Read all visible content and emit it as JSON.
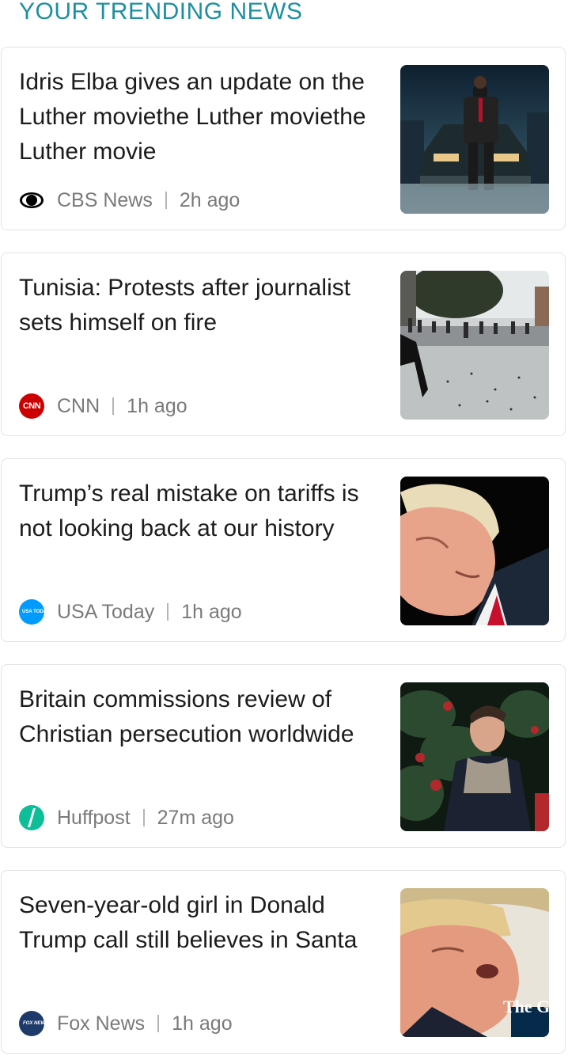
{
  "section": {
    "title": "YOUR TRENDING NEWS"
  },
  "colors": {
    "accent": "#1e8fa0",
    "cbs": "#000000",
    "cnn": "#cc0000",
    "usa_today": "#009bff",
    "huffpost": "#0dbe98",
    "fox": "#1d3a6b"
  },
  "articles": [
    {
      "headline": "Idris Elba gives an update on the Luther moviethe Luther moviethe Luther movie",
      "source": "CBS News",
      "time": "2h ago",
      "logo_icon": "cbs-eye-icon",
      "thumbnail": "man-standing-on-car-at-night"
    },
    {
      "headline": "Tunisia: Protests after journalist sets himself on fire",
      "source": "CNN",
      "time": "1h ago",
      "logo_icon": "cnn-logo-icon",
      "logo_text": "CNN",
      "thumbnail": "street-protest"
    },
    {
      "headline": "Trump’s real mistake on tariffs is not looking back at our history",
      "source": "USA Today",
      "time": "1h ago",
      "logo_icon": "usa-today-logo-icon",
      "logo_text": "USA TODAY",
      "thumbnail": "man-looking-down-portrait"
    },
    {
      "headline": "Britain commissions review of Christian persecution worldwide",
      "source": "Huffpost",
      "time": "27m ago",
      "logo_icon": "huffpost-logo-icon",
      "thumbnail": "man-with-scarf-outdoors"
    },
    {
      "headline": "Seven-year-old girl in Donald Trump call still believes in Santa",
      "source": "Fox News",
      "time": "1h ago",
      "logo_icon": "fox-news-logo-icon",
      "logo_text": "FOX NEWS",
      "thumbnail": "man-speaking-portrait",
      "thumbnail_overlay": "The Guardian"
    }
  ]
}
